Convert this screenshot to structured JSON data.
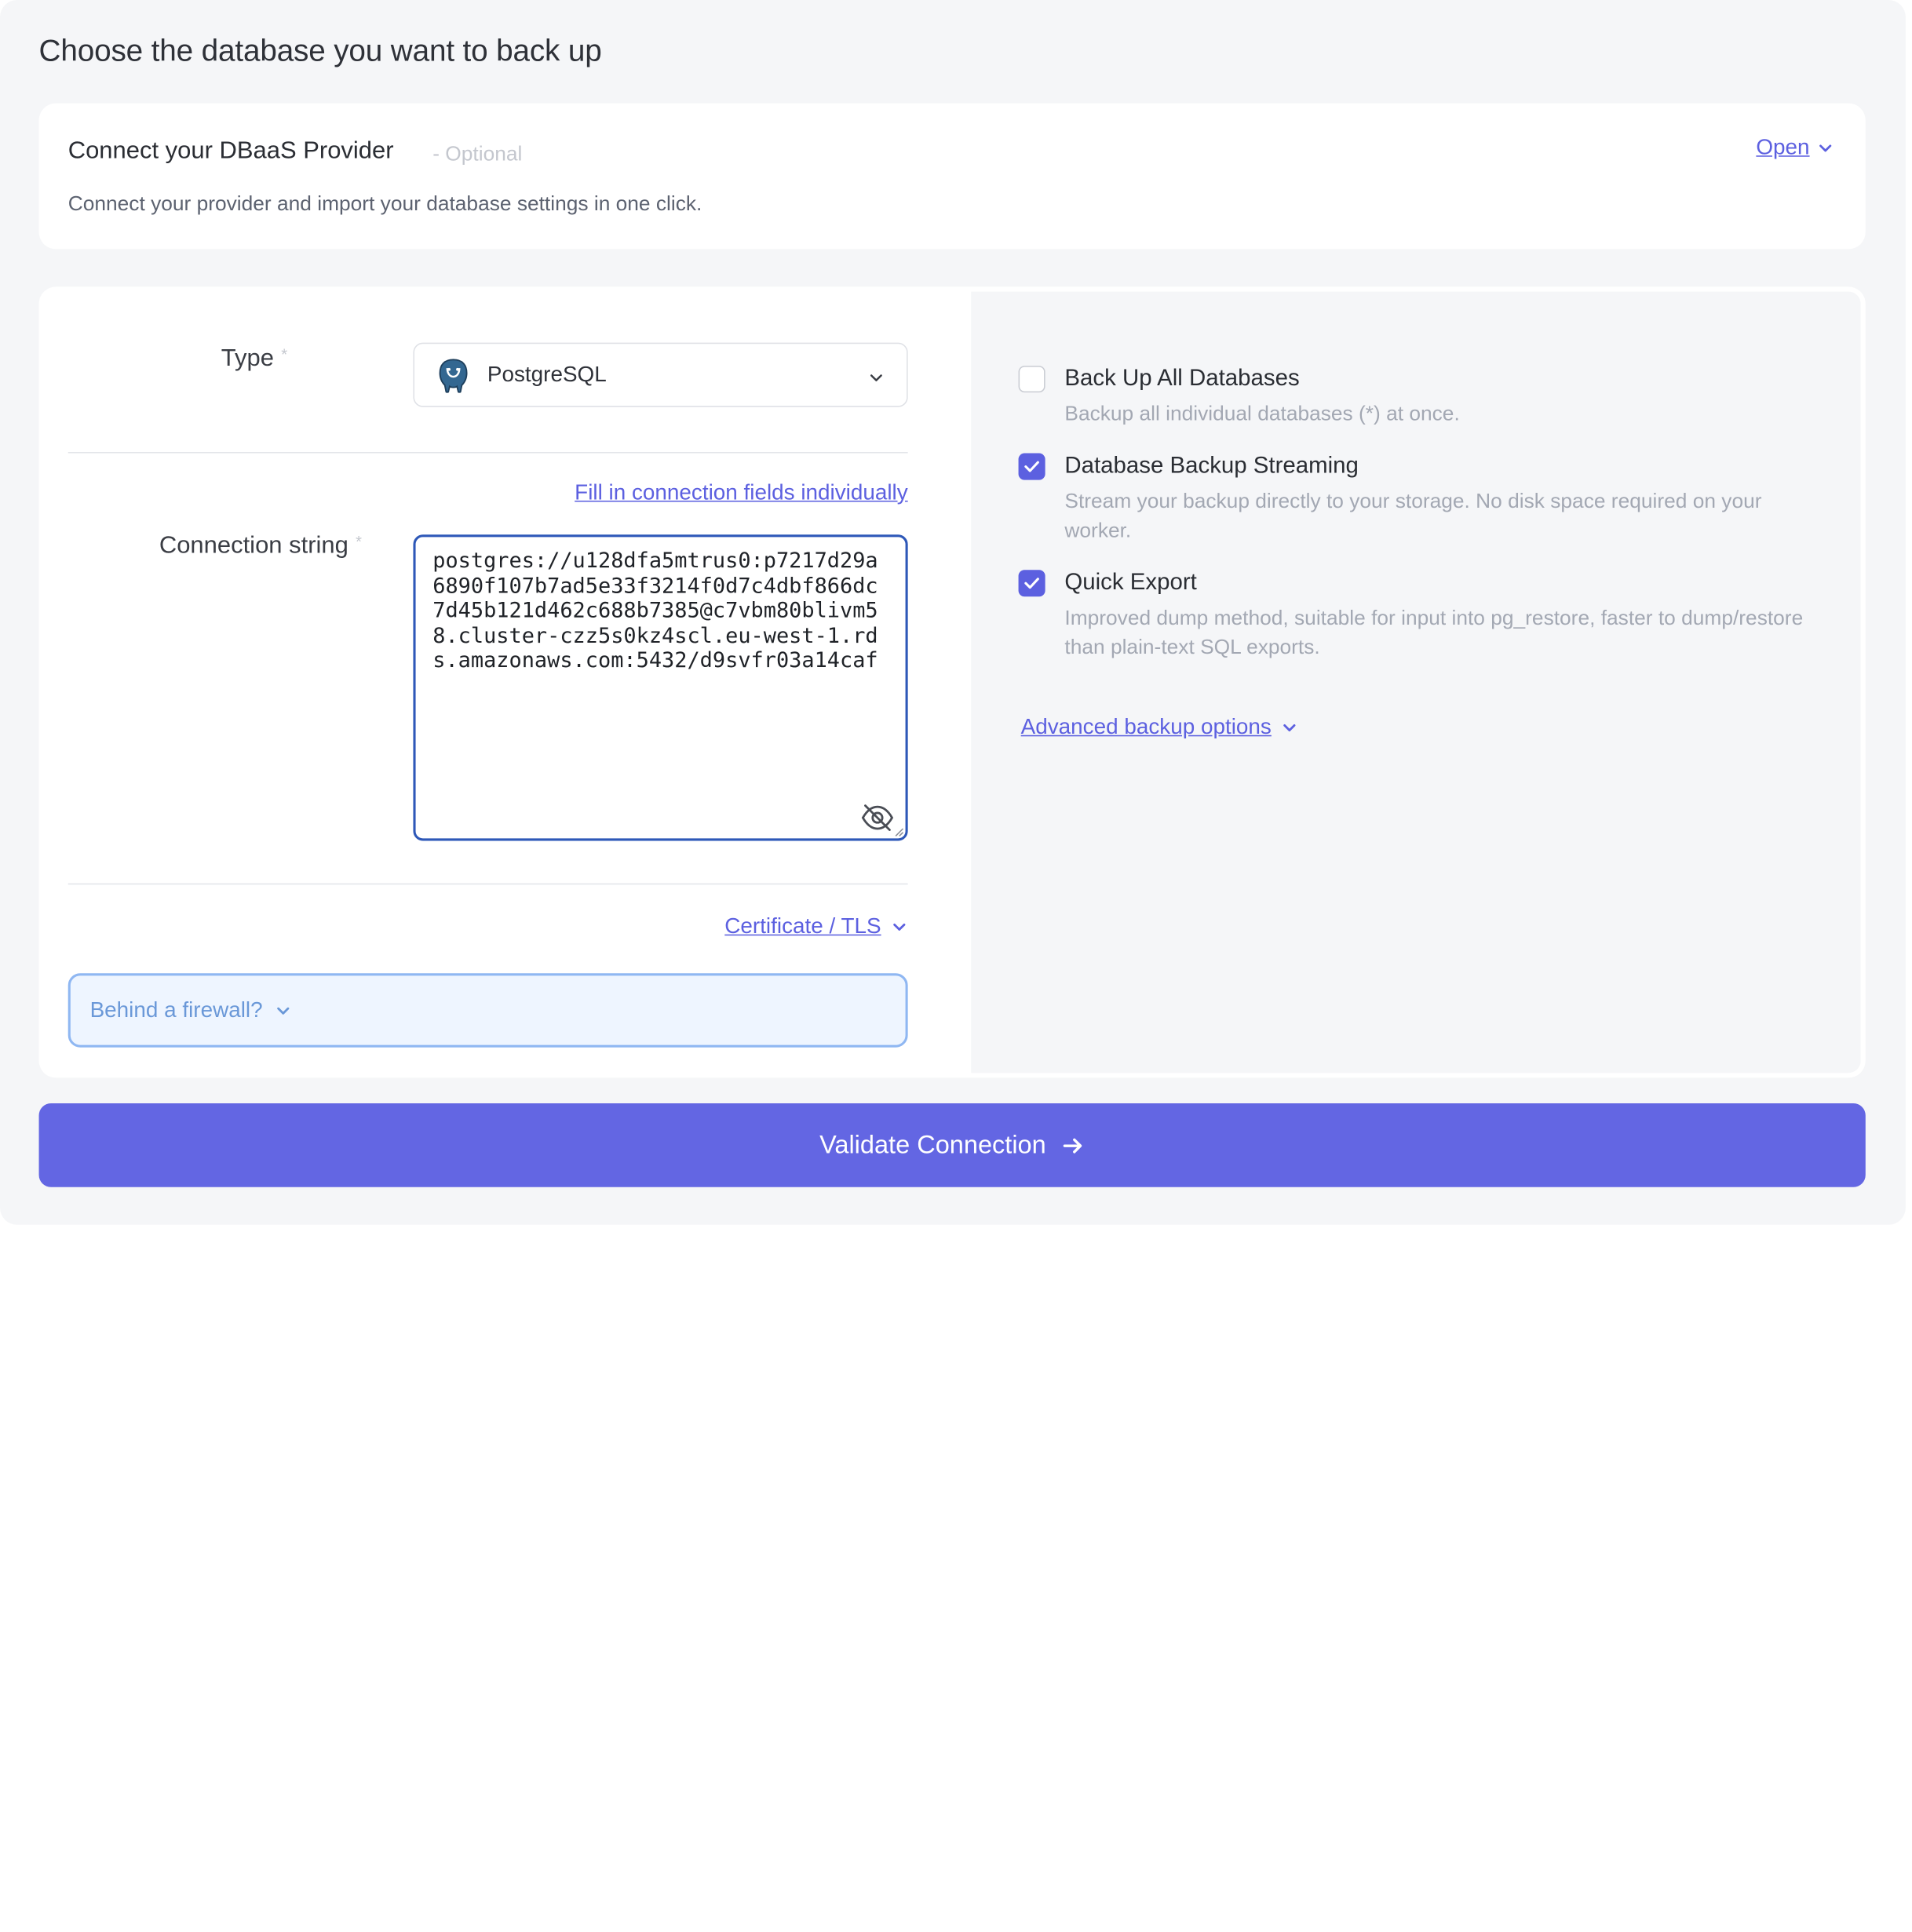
{
  "page": {
    "title": "Choose the database you want to back up"
  },
  "dbaas": {
    "title": "Connect your DBaaS Provider",
    "optional": "- Optional",
    "description": "Connect your provider and import your database settings in one click.",
    "open_label": "Open"
  },
  "form": {
    "type_label": "Type",
    "required_mark": "*",
    "type_value": "PostgreSQL",
    "type_icon": "postgresql-elephant-icon",
    "fill_fields_link": "Fill in connection fields individually",
    "connection_label": "Connection string",
    "connection_value": "postgres://u128dfa5mtrus0:p7217d29a6890f107b7ad5e33f3214f0d7c4dbf866dc7d45b121d462c688b7385@c7vbm80blivm58.cluster-czz5s0kz4scl.eu-west-1.rds.amazonaws.com:5432/d9svfr03a14caf",
    "cert_link": "Certificate / TLS",
    "firewall_label": "Behind a firewall?"
  },
  "options": [
    {
      "title": "Back Up All Databases",
      "description": "Backup all individual databases (*) at once.",
      "checked": false
    },
    {
      "title": "Database Backup Streaming",
      "description": "Stream your backup directly to your storage. No disk space required on your worker.",
      "checked": true
    },
    {
      "title": "Quick Export",
      "description": "Improved dump method, suitable for input into pg_restore, faster to dump/restore than plain-text SQL exports.",
      "checked": true
    }
  ],
  "advanced_link": "Advanced backup options",
  "validate_button": "Validate Connection",
  "colors": {
    "accent": "#6366e3",
    "link": "#5c60e0",
    "focus_border": "#2e58b8"
  }
}
